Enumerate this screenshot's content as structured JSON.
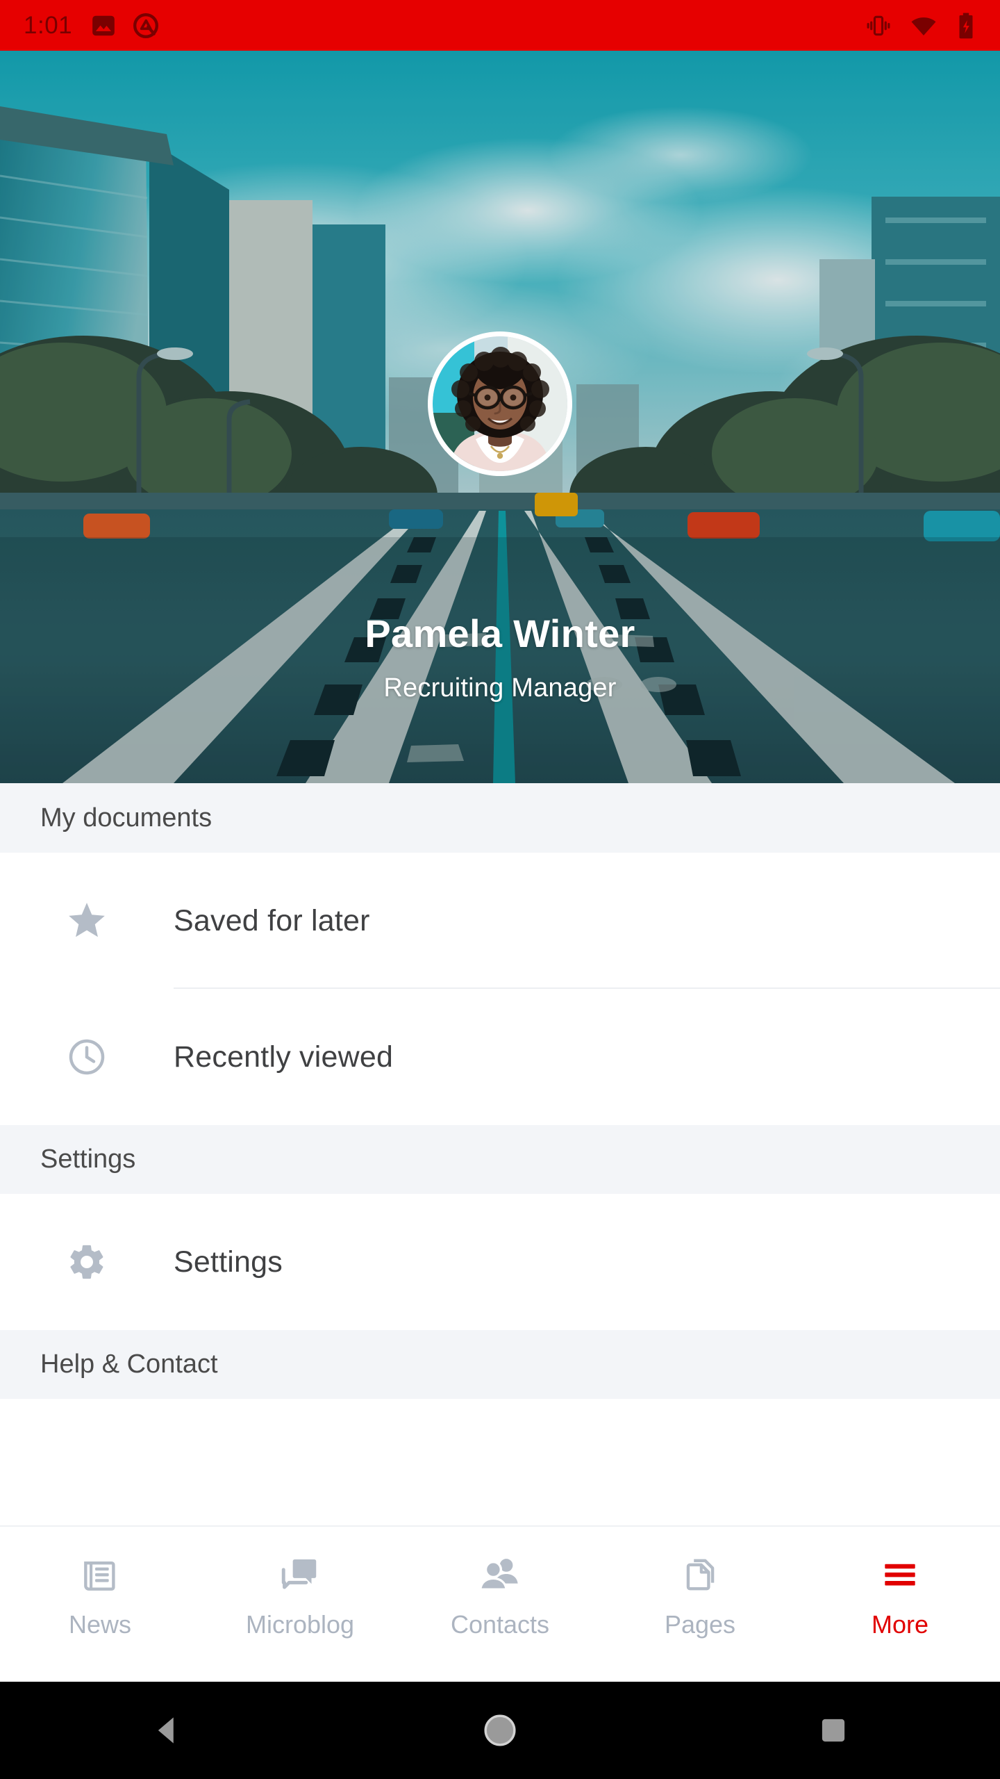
{
  "status_bar": {
    "time": "1:01",
    "background_color": "#E60000",
    "icon_color": "#7A0000",
    "left_icons": [
      "image-icon",
      "android-q-icon"
    ],
    "right_icons": [
      "vibrate-icon",
      "wifi-icon",
      "battery-charging-icon"
    ]
  },
  "hero": {
    "edit_icon": "pencil-icon",
    "avatar": "profile-avatar",
    "name": "Pamela Winter",
    "role": "Recruiting Manager",
    "image_description": "city-street-cover-photo"
  },
  "sections": [
    {
      "title": "My documents",
      "items": [
        {
          "label": "Saved for later",
          "icon": "star-icon",
          "divider": true
        },
        {
          "label": "Recently viewed",
          "icon": "clock-icon",
          "divider": false
        }
      ]
    },
    {
      "title": "Settings",
      "items": [
        {
          "label": "Settings",
          "icon": "gear-icon",
          "divider": false
        }
      ]
    },
    {
      "title": "Help & Contact",
      "items": []
    }
  ],
  "bottom_nav": {
    "active_color": "#E10000",
    "inactive_color": "#ACB4C0",
    "items": [
      {
        "label": "News",
        "icon": "newspaper-icon",
        "active": false
      },
      {
        "label": "Microblog",
        "icon": "chat-bubbles-icon",
        "active": false
      },
      {
        "label": "Contacts",
        "icon": "people-icon",
        "active": false
      },
      {
        "label": "Pages",
        "icon": "documents-icon",
        "active": false
      },
      {
        "label": "More",
        "icon": "hamburger-menu-icon",
        "active": true
      }
    ]
  },
  "android_nav": {
    "back": "back-triangle-icon",
    "home": "home-circle-icon",
    "recents": "recents-square-icon"
  }
}
